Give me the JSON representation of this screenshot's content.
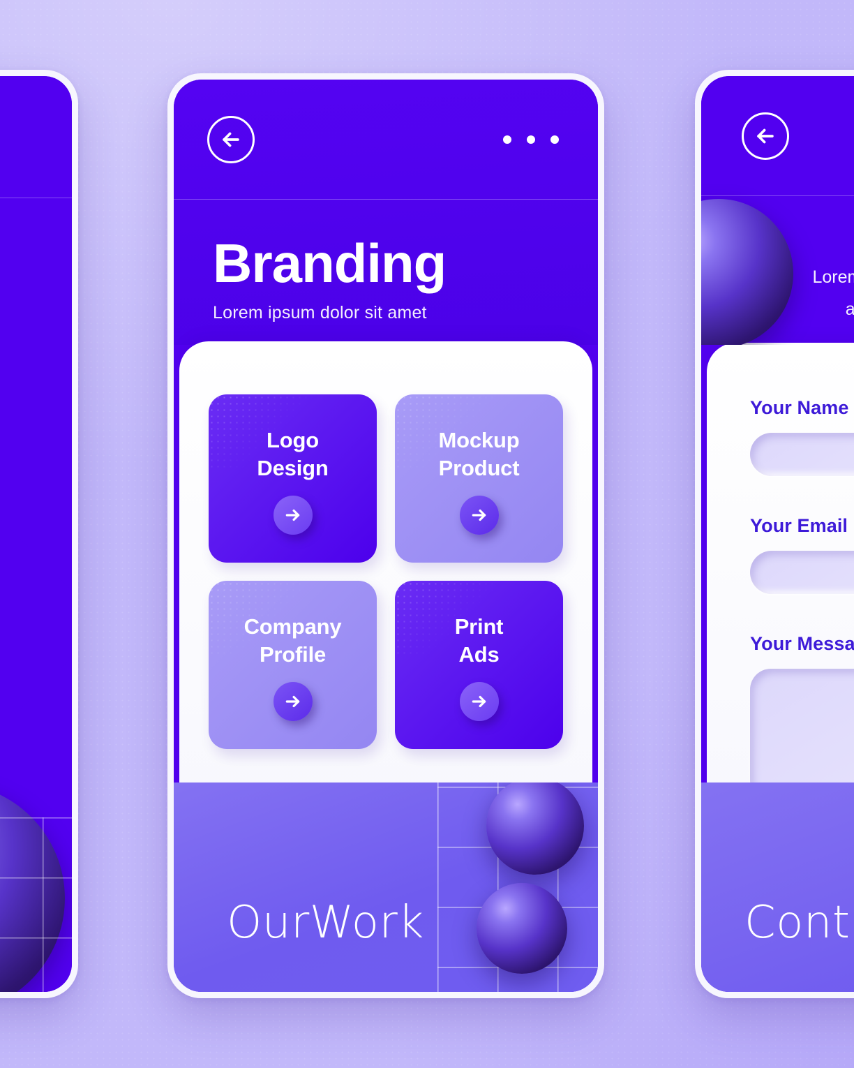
{
  "theme": {
    "backdrop": "#c2b8fa",
    "primary_purple": "#5200f0",
    "accent_light_purple": "#9f8ff5",
    "panel_white": "#ffffff",
    "footer_purple": "#7b6cf0",
    "label_blue": "#3d1ad8"
  },
  "left_screen": {
    "menu_icon": "more-dots-icon",
    "decor": [
      "x-shape",
      "sphere",
      "grid-lines"
    ]
  },
  "center_screen": {
    "header": {
      "back_icon": "arrow-left-icon",
      "menu_icon": "more-dots-icon",
      "title": "Branding",
      "subtitle": "Lorem ipsum dolor sit amet"
    },
    "tiles": [
      {
        "label": "Logo\nDesign",
        "style": "dark",
        "arrow_icon": "arrow-right-icon"
      },
      {
        "label": "Mockup\nProduct",
        "style": "light",
        "arrow_icon": "arrow-right-icon"
      },
      {
        "label": "Company\nProfile",
        "style": "light",
        "arrow_icon": "arrow-right-icon"
      },
      {
        "label": "Print\nAds",
        "style": "dark",
        "arrow_icon": "arrow-right-icon"
      }
    ],
    "pager": {
      "icon": "chevron-right-icon"
    },
    "footer": {
      "word": "OurWork"
    }
  },
  "right_screen": {
    "header": {
      "back_icon": "arrow-left-icon",
      "ring_icon": "circle-slash-icon",
      "lead_line_1": "Lorem ipsum",
      "lead_line_2": "adipiscin"
    },
    "form": {
      "fields": [
        {
          "label": "Your Name",
          "type": "text"
        },
        {
          "label": "Your Email",
          "type": "text"
        },
        {
          "label": "Your Message",
          "type": "textarea"
        }
      ]
    },
    "footer": {
      "word": "Cont"
    }
  }
}
